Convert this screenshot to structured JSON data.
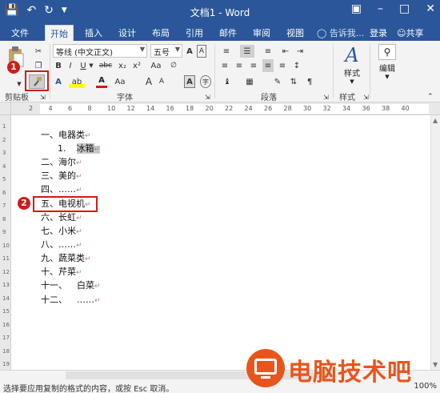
{
  "titlebar": {
    "title": "文档1 - Word",
    "save_icon": "save-icon",
    "undo_icon": "undo-icon",
    "redo_icon": "redo-icon"
  },
  "tabs": {
    "file": "文件",
    "home": "开始",
    "insert": "插入",
    "design": "设计",
    "layout": "布局",
    "references": "引用",
    "mailings": "邮件",
    "review": "审阅",
    "view": "视图",
    "tell_me": "告诉我...",
    "login": "登录",
    "share": "共享"
  },
  "ribbon": {
    "font_name": "等线 (中文正文)",
    "font_size": "五号",
    "clipboard_label": "剪贴板",
    "font_label": "字体",
    "paragraph_label": "段落",
    "styles_label": "样式",
    "styles_button": "样式",
    "editing_button": "编辑",
    "wen_label": "wén",
    "font_grow": "A",
    "font_shrink": "A",
    "change_case": "Aa",
    "bold": "B",
    "italic": "I",
    "underline": "U",
    "strike": "abc",
    "subscript": "x₂",
    "superscript": "x²",
    "text_effects": "A",
    "highlight": "ab",
    "font_color": "A",
    "accent_color": "#2b579a"
  },
  "ruler": {
    "numbers": [
      "2",
      "4",
      "6",
      "8",
      "10",
      "12",
      "14",
      "16",
      "18",
      "20",
      "22",
      "24",
      "26",
      "28",
      "30",
      "32",
      "34",
      "36",
      "38",
      "40"
    ],
    "vnumbers": [
      "1",
      "2",
      "3",
      "4",
      "5",
      "6",
      "7",
      "8",
      "9",
      "10",
      "11",
      "12",
      "13",
      "14",
      "15",
      "16",
      "17",
      "18",
      "19"
    ]
  },
  "document": {
    "lines": [
      {
        "text": "一、电器类"
      },
      {
        "prefix": "1.",
        "text": "冰箱"
      },
      {
        "text": "二、海尔"
      },
      {
        "text": "三、美的"
      },
      {
        "text": "四、……"
      },
      {
        "text": "五、电视机"
      },
      {
        "text": "六、长虹"
      },
      {
        "text": "七、小米"
      },
      {
        "text": "八、……"
      },
      {
        "text": "九、蔬菜类"
      },
      {
        "text": "十、芹菜"
      },
      {
        "prefix": "十一、",
        "text": "白菜"
      },
      {
        "prefix": "十二、",
        "text": "……"
      }
    ],
    "paragraph_mark": "↵"
  },
  "annotations": {
    "marker1": "1",
    "marker2": "2",
    "color": "#d11a1a"
  },
  "status": {
    "message": "选择要应用复制的格式的内容，或按 Esc 取消。",
    "zoom": "100%"
  },
  "watermark": {
    "text": "电脑技术吧",
    "color": "#e8551c"
  }
}
